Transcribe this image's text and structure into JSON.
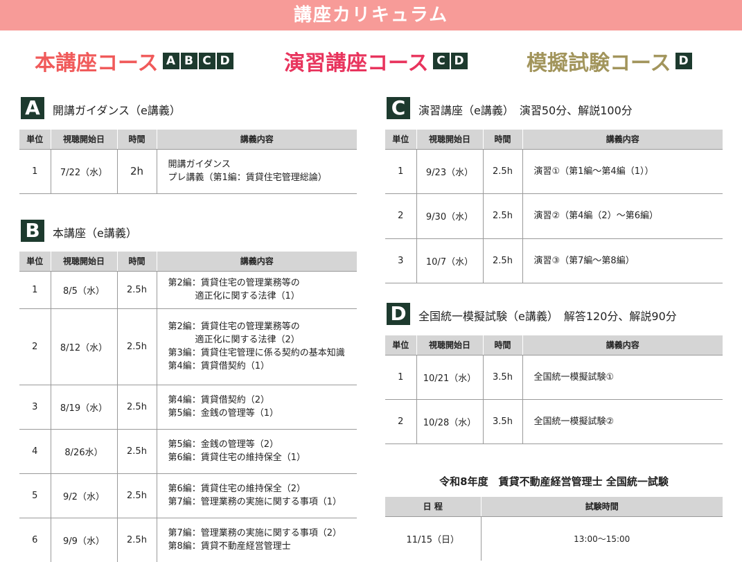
{
  "banner": "講座カリキュラム",
  "courses": [
    {
      "name": "本講座コース",
      "badges": [
        "A",
        "B",
        "C",
        "D"
      ]
    },
    {
      "name": "演習講座コース",
      "badges": [
        "C",
        "D"
      ]
    },
    {
      "name": "模擬試験コース",
      "badges": [
        "D"
      ]
    }
  ],
  "headers": {
    "unit": "単位",
    "start": "視聴開始日",
    "time": "時間",
    "content": "講義内容"
  },
  "sections": {
    "A": {
      "letter": "A",
      "title": "開講ガイダンス（e講義）",
      "rows": [
        {
          "unit": "1",
          "date": "7/22（水）",
          "time": "2h",
          "content": [
            "開講ガイダンス",
            "プレ講義（第1編：賃貸住宅管理総論）"
          ]
        }
      ]
    },
    "B": {
      "letter": "B",
      "title": "本講座（e講義）",
      "rows": [
        {
          "unit": "1",
          "date": "8/5（水）",
          "time": "2.5h",
          "content": [
            "第2編：賃貸住宅の管理業務等の",
            "　　　適正化に関する法律（1）"
          ]
        },
        {
          "unit": "2",
          "date": "8/12（水）",
          "time": "2.5h",
          "content": [
            "第2編：賃貸住宅の管理業務等の",
            "　　　適正化に関する法律（2）",
            "第3編：賃貸住宅管理に係る契約の基本知識",
            "第4編：賃貸借契約（1）"
          ]
        },
        {
          "unit": "3",
          "date": "8/19（水）",
          "time": "2.5h",
          "content": [
            "第4編：賃貸借契約（2）",
            "第5編：金銭の管理等（1）"
          ]
        },
        {
          "unit": "4",
          "date": "8/26水）",
          "time": "2.5h",
          "content": [
            "第5編：金銭の管理等（2）",
            "第6編：賃貸住宅の維持保全（1）"
          ]
        },
        {
          "unit": "5",
          "date": "9/2（水）",
          "time": "2.5h",
          "content": [
            "第6編：賃貸住宅の維持保全（2）",
            "第7編：管理業務の実施に関する事項（1）"
          ]
        },
        {
          "unit": "6",
          "date": "9/9（水）",
          "time": "2.5h",
          "content": [
            "第7編：管理業務の実施に関する事項（2）",
            "第8編：賃貸不動産経営管理士"
          ]
        }
      ]
    },
    "C": {
      "letter": "C",
      "title": "演習講座（e講義）　演習50分、解説100分",
      "rows": [
        {
          "unit": "1",
          "date": "9/23（水）",
          "time": "2.5h",
          "content": [
            "演習①（第1編～第4編（1））"
          ]
        },
        {
          "unit": "2",
          "date": "9/30（水）",
          "time": "2.5h",
          "content": [
            "演習②（第4編（2）～第6編）"
          ]
        },
        {
          "unit": "3",
          "date": "10/7（水）",
          "time": "2.5h",
          "content": [
            "演習③（第7編～第8編）"
          ]
        }
      ]
    },
    "D": {
      "letter": "D",
      "title": "全国統一模擬試験（e講義）　解答120分、解説90分",
      "rows": [
        {
          "unit": "1",
          "date": "10/21（水）",
          "time": "3.5h",
          "content": [
            "全国統一模擬試験①"
          ]
        },
        {
          "unit": "2",
          "date": "10/28（水）",
          "time": "3.5h",
          "content": [
            "全国統一模擬試験②"
          ]
        }
      ]
    }
  },
  "exam": {
    "title": "令和8年度　賃貸不動産経営管理士 全国統一試験",
    "header_date": "日 程",
    "header_time": "試験時間",
    "date": "11/15（日）",
    "time": "13:00～15:00"
  }
}
